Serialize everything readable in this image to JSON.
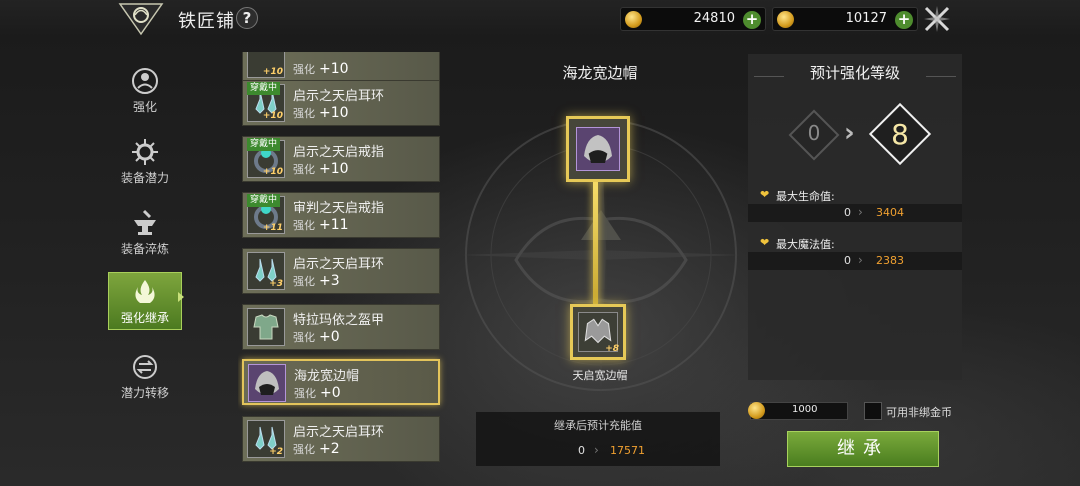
{
  "header": {
    "title": "铁匠铺",
    "help_label": "?",
    "currency_gold": "24810",
    "currency_diamond": "10127",
    "add_label": "+"
  },
  "nav": [
    {
      "label": "强化",
      "icon": "hammer-shield-icon"
    },
    {
      "label": "装备潜力",
      "icon": "gear-icon"
    },
    {
      "label": "装备淬炼",
      "icon": "anvil-icon"
    },
    {
      "label": "强化继承",
      "icon": "flame-icon"
    },
    {
      "label": "潜力转移",
      "icon": "transfer-icon"
    }
  ],
  "items": [
    {
      "name": "",
      "enh_label": "强化",
      "enh": "+10",
      "level": "+10",
      "equipped": "",
      "icon": "amulet-icon"
    },
    {
      "name": "启示之天启耳环",
      "enh_label": "强化",
      "enh": "+10",
      "level": "+10",
      "equipped": "穿戴中",
      "icon": "earring-icon"
    },
    {
      "name": "启示之天启戒指",
      "enh_label": "强化",
      "enh": "+10",
      "level": "+10",
      "equipped": "穿戴中",
      "icon": "ring-icon"
    },
    {
      "name": "审判之天启戒指",
      "enh_label": "强化",
      "enh": "+11",
      "level": "+11",
      "equipped": "穿戴中",
      "icon": "ring-icon"
    },
    {
      "name": "启示之天启耳环",
      "enh_label": "强化",
      "enh": "+3",
      "level": "+3",
      "equipped": "",
      "icon": "earring-icon"
    },
    {
      "name": "特拉玛依之盔甲",
      "enh_label": "强化",
      "enh": "+0",
      "level": "",
      "equipped": "",
      "icon": "armor-icon"
    },
    {
      "name": "海龙宽边帽",
      "enh_label": "强化",
      "enh": "+0",
      "level": "",
      "equipped": "",
      "icon": "hat-icon"
    },
    {
      "name": "启示之天启耳环",
      "enh_label": "强化",
      "enh": "+2",
      "level": "+2",
      "equipped": "",
      "icon": "earring-icon"
    }
  ],
  "center": {
    "target_name": "海龙宽边帽",
    "source_name": "天启宽边帽",
    "source_level": "+8",
    "charge_label": "继承后预计充能值",
    "charge_from": "0",
    "charge_to": "17571"
  },
  "right": {
    "title": "预计强化等级",
    "level_from": "0",
    "level_to": "8",
    "stats": [
      {
        "label": "最大生命值:",
        "from": "0",
        "to": "3404"
      },
      {
        "label": "最大魔法值:",
        "from": "0",
        "to": "2383"
      }
    ]
  },
  "actions": {
    "cost": "1000",
    "unbound_label": "可用非绑金币",
    "inherit_label": "继承"
  },
  "colors": {
    "accent_green": "#5f9530",
    "gold_border": "#e6c957",
    "value_orange": "#f0a030"
  }
}
